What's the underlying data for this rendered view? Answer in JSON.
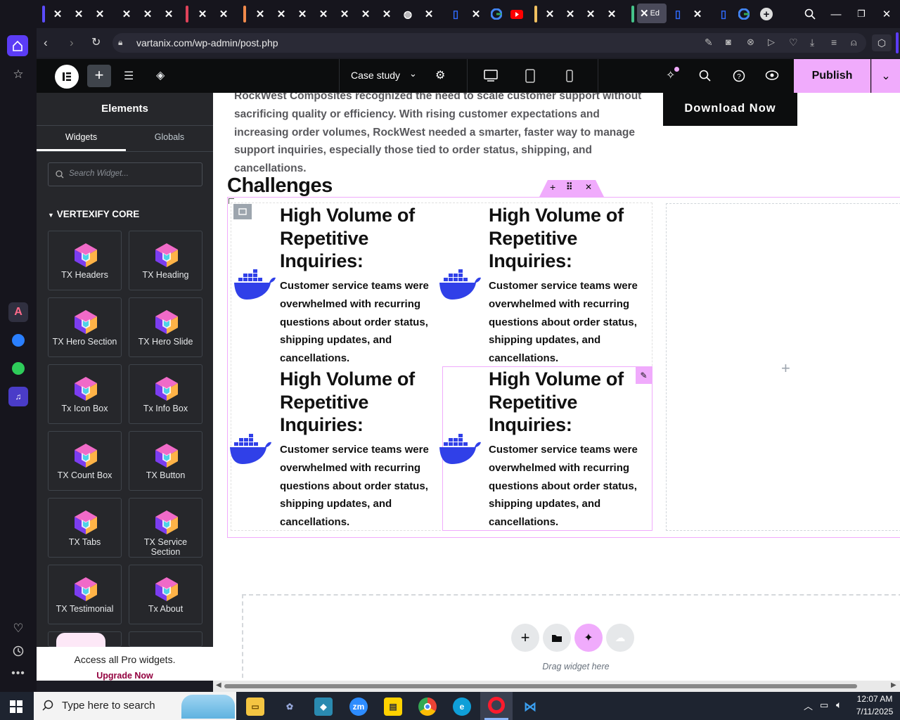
{
  "browser": {
    "url": "vartanix.com/wp-admin/post.php",
    "active_tab_label": "Ed"
  },
  "editor": {
    "page_name": "Case study",
    "publish_label": "Publish"
  },
  "panel": {
    "title": "Elements",
    "tabs": [
      "Widgets",
      "Globals"
    ],
    "search_placeholder": "Search Widget...",
    "category": "VERTEXIFY CORE",
    "widgets": [
      "TX Headers",
      "TX Heading",
      "TX Hero Section",
      "TX Hero Slide",
      "Tx Icon Box",
      "Tx Info Box",
      "TX Count Box",
      "TX Button",
      "TX Tabs",
      "TX Service Section",
      "TX Testimonial",
      "Tx About"
    ],
    "promo_text": "Access all Pro widgets.",
    "promo_link": "Upgrade Now"
  },
  "canvas": {
    "intro_text": "RockWest Composites recognized the need to scale customer support without sacrificing quality or efficiency. With rising customer expectations and increasing order volumes, RockWest needed a smarter, faster way to manage support inquiries, especially those tied to order status, shipping, and cancellations.",
    "download_button": "Download Now",
    "section_heading": "Challenges",
    "cards": [
      {
        "heading": "High Volume of Repetitive Inquiries:",
        "body": "Customer service teams were overwhelmed with recurring questions about order status, shipping updates, and cancellations."
      },
      {
        "heading": "High Volume of Repetitive Inquiries:",
        "body": "Customer service teams were overwhelmed with recurring questions about order status, shipping updates, and cancellations."
      },
      {
        "heading": "High Volume of Repetitive Inquiries:",
        "body": "Customer service teams were overwhelmed with recurring questions about order status, shipping updates, and cancellations."
      },
      {
        "heading": "High Volume of Repetitive Inquiries:",
        "body": "Customer service teams were overwhelmed with recurring questions about order status, shipping updates, and cancellations."
      }
    ],
    "drop_hint": "Drag widget here"
  },
  "taskbar": {
    "search_placeholder": "Type here to search",
    "time": "12:07 AM",
    "date": "7/11/2025"
  },
  "colors": {
    "accent_pink": "#f0abfc",
    "whale_blue": "#3040e8",
    "elementor_dark": "#0c0d0e"
  }
}
